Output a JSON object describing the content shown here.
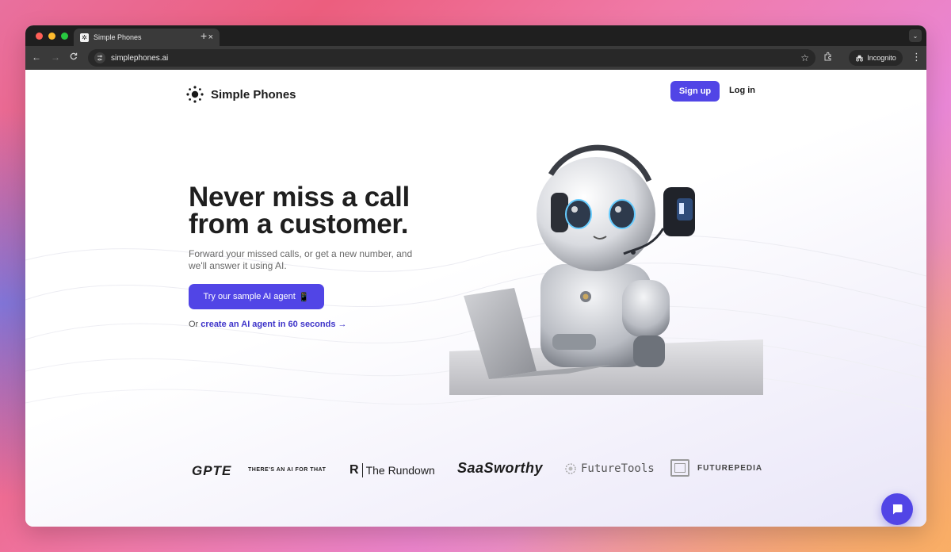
{
  "browser": {
    "tab_title": "Simple Phones",
    "tab_favicon": "✲",
    "tab_close": "×",
    "new_tab": "+",
    "url": "simplephones.ai",
    "incognito_label": "Incognito",
    "back_icon": "←",
    "forward_icon": "→",
    "reload_icon": "C",
    "star_icon": "☆",
    "menu_icon": "⋮",
    "tab_menu_icon": "⌄"
  },
  "header": {
    "logo_text": "Simple Phones",
    "signup_label": "Sign up",
    "login_label": "Log in"
  },
  "hero": {
    "title": "Never miss a call from a customer.",
    "subtitle": "Forward your missed calls, or get a new number, and we'll answer it using AI.",
    "cta_label": "Try our sample AI agent",
    "cta_emoji": "📱",
    "or_prefix": "Or",
    "link_text": "create an AI agent in 60 seconds →"
  },
  "logos": {
    "gpte": "GPTE",
    "aift": "THERE'S AN AI FOR THAT",
    "rundown": "The Rundown",
    "rundown_mark": "R",
    "saasworthy": "SaaSworthy",
    "futuretools": "FutureTools",
    "futurepedia": "FUTUREPEDIA"
  },
  "colors": {
    "accent": "#5145e6",
    "link": "#3d33c9",
    "chrome_dark": "#1f1f1f",
    "chrome_toolbar": "#3a3a3a"
  }
}
